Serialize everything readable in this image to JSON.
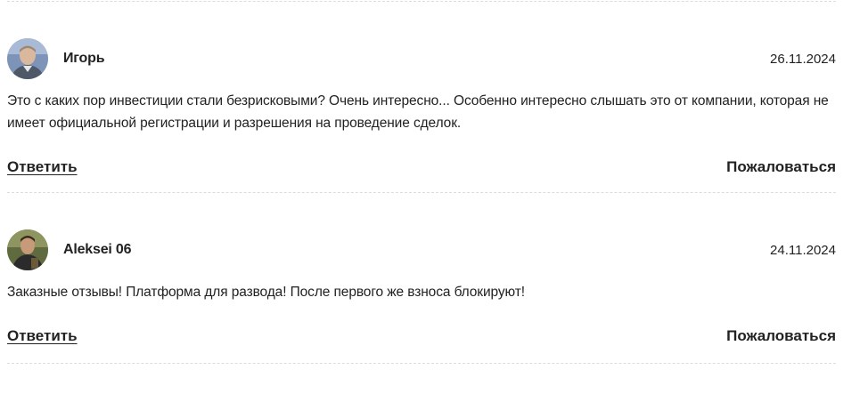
{
  "comments": [
    {
      "author": "Игорь",
      "date": "26.11.2024",
      "text": "Это с каких пор инвестиции стали безрисковыми? Очень интересно... Особенно интересно слышать это от компании, которая не имеет официальной регистрации и разрешения на проведение сделок.",
      "reply_label": "Ответить",
      "report_label": "Пожаловаться",
      "avatar": "user-photo-icon"
    },
    {
      "author": "Aleksei 06",
      "date": "24.11.2024",
      "text": "Заказные отзывы! Платформа для развода! После первого же взноса блокируют!",
      "reply_label": "Ответить",
      "report_label": "Пожаловаться",
      "avatar": "user-photo-icon"
    }
  ]
}
